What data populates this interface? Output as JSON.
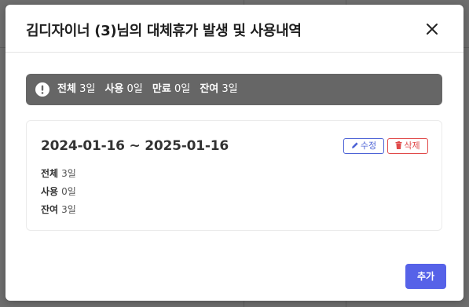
{
  "modal": {
    "title": "김디자이너 (3)님의 대체휴가 발생 및 사용내역"
  },
  "summary": {
    "total_label": "전체",
    "total_value": "3일",
    "used_label": "사용",
    "used_value": "0일",
    "expired_label": "만료",
    "expired_value": "0일",
    "remaining_label": "잔여",
    "remaining_value": "3일"
  },
  "record": {
    "period": "2024-01-16 ~ 2025-01-16",
    "edit_label": "수정",
    "delete_label": "삭제",
    "total_label": "전체",
    "total_value": "3일",
    "used_label": "사용",
    "used_value": "0일",
    "remaining_label": "잔여",
    "remaining_value": "3일"
  },
  "footer": {
    "add_label": "추가"
  },
  "icons": {
    "close": "close-icon",
    "alert": "exclamation-circle-icon",
    "edit": "pencil-icon",
    "delete": "trash-icon"
  },
  "colors": {
    "summary_bg": "#666666",
    "edit": "#4d63d6",
    "delete": "#e04a4a",
    "primary": "#5662e8"
  }
}
